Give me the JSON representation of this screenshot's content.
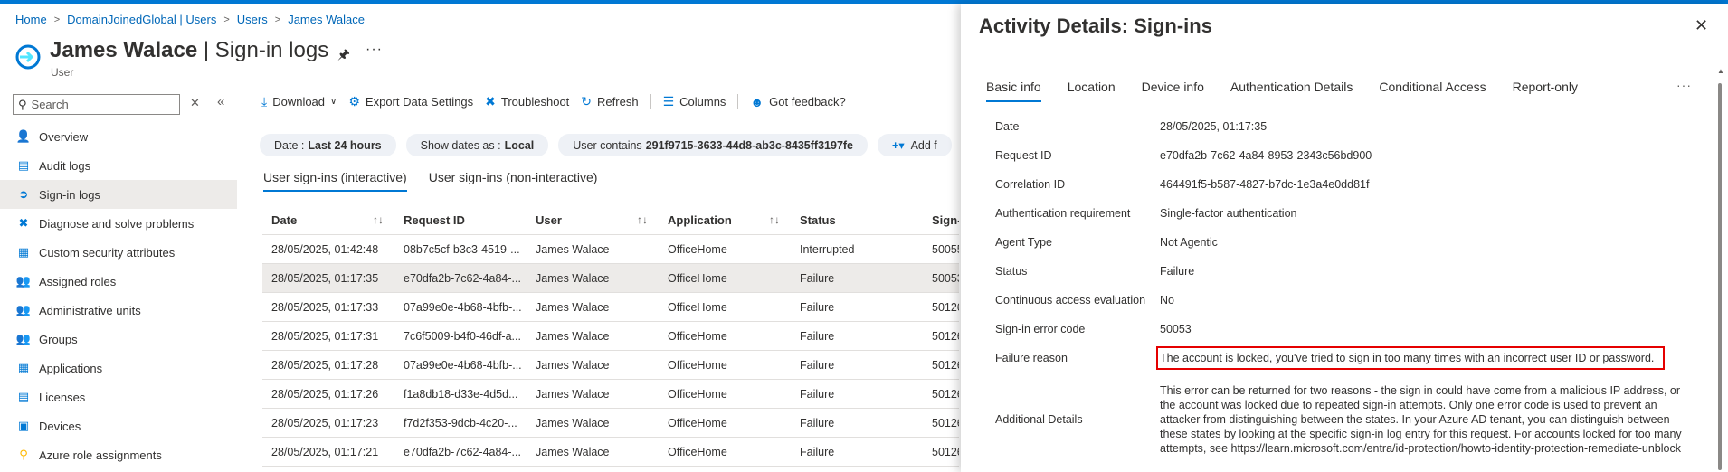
{
  "breadcrumb": [
    "Home",
    "DomainJoinedGlobal | Users",
    "Users",
    "James Walace"
  ],
  "header": {
    "title": "James Walace",
    "title_sep": " | ",
    "title_suffix": "Sign-in logs",
    "subtitle": "User"
  },
  "nav": {
    "search_placeholder": "Search",
    "items": [
      {
        "label": "Overview",
        "icon": "person-icon",
        "color": "#0078d4"
      },
      {
        "label": "Audit logs",
        "icon": "audit-log-icon",
        "color": "#0078d4"
      },
      {
        "label": "Sign-in logs",
        "icon": "sign-in-icon",
        "color": "#0078d4"
      },
      {
        "label": "Diagnose and solve problems",
        "icon": "wrench-icon",
        "color": "#0078d4"
      },
      {
        "label": "Custom security attributes",
        "icon": "attributes-icon",
        "color": "#0078d4"
      },
      {
        "label": "Assigned roles",
        "icon": "roles-icon",
        "color": "#107c10"
      },
      {
        "label": "Administrative units",
        "icon": "admin-units-icon",
        "color": "#0078d4"
      },
      {
        "label": "Groups",
        "icon": "groups-icon",
        "color": "#0078d4"
      },
      {
        "label": "Applications",
        "icon": "applications-icon",
        "color": "#0078d4"
      },
      {
        "label": "Licenses",
        "icon": "licenses-icon",
        "color": "#0078d4"
      },
      {
        "label": "Devices",
        "icon": "devices-icon",
        "color": "#0078d4"
      },
      {
        "label": "Azure role assignments",
        "icon": "key-icon",
        "color": "#ffb900"
      }
    ]
  },
  "toolbar": {
    "download": "Download",
    "export": "Export Data Settings",
    "troubleshoot": "Troubleshoot",
    "refresh": "Refresh",
    "columns": "Columns",
    "feedback": "Got feedback?"
  },
  "filters": {
    "date_label": "Date :",
    "date_value": "Last 24 hours",
    "show_dates_label": "Show dates as :",
    "show_dates_value": "Local",
    "user_label": "User contains",
    "user_value": "291f9715-3633-44d8-ab3c-8435ff3197fe",
    "add_filter": "Add f"
  },
  "list_tabs": [
    "User sign-ins (interactive)",
    "User sign-ins (non-interactive)"
  ],
  "table": {
    "headers": [
      "Date",
      "Request ID",
      "User",
      "Application",
      "Status",
      "Sign-"
    ],
    "rows": [
      [
        "28/05/2025, 01:42:48",
        "08b7c5cf-b3c3-4519-...",
        "James Walace",
        "OfficeHome",
        "Interrupted",
        "50055"
      ],
      [
        "28/05/2025, 01:17:35",
        "e70dfa2b-7c62-4a84-...",
        "James Walace",
        "OfficeHome",
        "Failure",
        "50053"
      ],
      [
        "28/05/2025, 01:17:33",
        "07a99e0e-4b68-4bfb-...",
        "James Walace",
        "OfficeHome",
        "Failure",
        "50126"
      ],
      [
        "28/05/2025, 01:17:31",
        "7c6f5009-b4f0-46df-a...",
        "James Walace",
        "OfficeHome",
        "Failure",
        "50126"
      ],
      [
        "28/05/2025, 01:17:28",
        "07a99e0e-4b68-4bfb-...",
        "James Walace",
        "OfficeHome",
        "Failure",
        "50126"
      ],
      [
        "28/05/2025, 01:17:26",
        "f1a8db18-d33e-4d5d...",
        "James Walace",
        "OfficeHome",
        "Failure",
        "50126"
      ],
      [
        "28/05/2025, 01:17:23",
        "f7d2f353-9dcb-4c20-...",
        "James Walace",
        "OfficeHome",
        "Failure",
        "50126"
      ],
      [
        "28/05/2025, 01:17:21",
        "e70dfa2b-7c62-4a84-...",
        "James Walace",
        "OfficeHome",
        "Failure",
        "50126"
      ]
    ]
  },
  "panel": {
    "title": "Activity Details: Sign-ins",
    "tabs": [
      "Basic info",
      "Location",
      "Device info",
      "Authentication Details",
      "Conditional Access",
      "Report-only"
    ],
    "details": [
      {
        "key": "Date",
        "value": "28/05/2025, 01:17:35"
      },
      {
        "key": "Request ID",
        "value": "e70dfa2b-7c62-4a84-8953-2343c56bd900"
      },
      {
        "key": "Correlation ID",
        "value": "464491f5-b587-4827-b7dc-1e3a4e0dd81f"
      },
      {
        "key": "Authentication requirement",
        "value": "Single-factor authentication"
      },
      {
        "key": "Agent Type",
        "value": "Not Agentic"
      },
      {
        "key": "Status",
        "value": "Failure"
      },
      {
        "key": "Continuous access evaluation",
        "value": "No"
      },
      {
        "key": "Sign-in error code",
        "value": "50053"
      },
      {
        "key": "Failure reason",
        "value": "The account is locked, you've tried to sign in too many times with an incorrect user ID or password."
      },
      {
        "key": "Additional Details",
        "value": "This error can be returned for two reasons - the sign in could have come from a malicious IP address, or the account was locked due to repeated sign-in attempts. Only one error code is used to prevent an attacker from distinguishing between the states. In your Azure AD tenant, you can distinguish between these states by looking at the specific sign-in log entry for this request. For accounts locked for too many attempts, see https://learn.microsoft.com/entra/id-protection/howto-identity-protection-remediate-unblock"
      }
    ]
  },
  "colors": {
    "accent": "#0078d4",
    "highlight_border": "#e50000"
  }
}
